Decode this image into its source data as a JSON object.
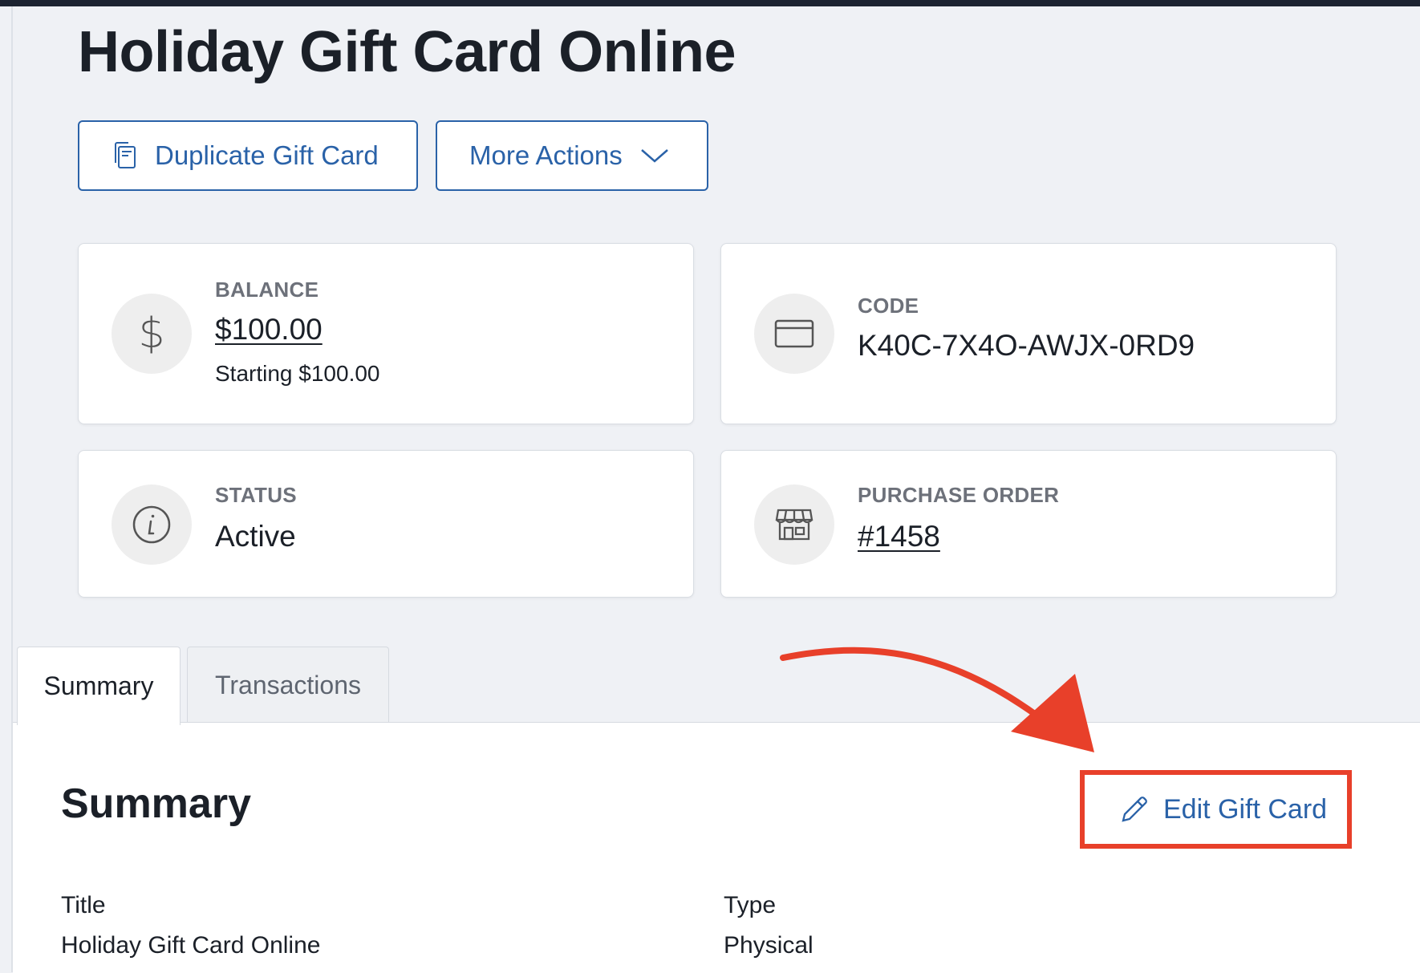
{
  "header": {
    "title": "Holiday Gift Card Online"
  },
  "actions": {
    "duplicate_label": "Duplicate Gift Card",
    "duplicate_icon": "copy-icon",
    "more_label": "More Actions",
    "more_icon": "chevron-down-icon"
  },
  "cards": {
    "balance": {
      "caption": "BALANCE",
      "value": "$100.00",
      "starting": "Starting $100.00",
      "icon": "dollar-icon"
    },
    "code": {
      "caption": "CODE",
      "value": "K40C-7X4O-AWJX-0RD9",
      "icon": "credit-card-icon"
    },
    "status": {
      "caption": "STATUS",
      "value": "Active",
      "icon": "info-icon"
    },
    "purchase_order": {
      "caption": "PURCHASE ORDER",
      "value": "#1458",
      "icon": "store-icon"
    }
  },
  "tabs": [
    {
      "label": "Summary",
      "active": true
    },
    {
      "label": "Transactions",
      "active": false
    }
  ],
  "summary": {
    "heading": "Summary",
    "edit_label": "Edit Gift Card",
    "edit_icon": "pencil-icon",
    "fields": {
      "title_label": "Title",
      "title_value": "Holiday Gift Card Online",
      "type_label": "Type",
      "type_value": "Physical"
    }
  },
  "colors": {
    "accent": "#2a62a8",
    "annotation": "#e8402a",
    "page_bg": "#eff1f5"
  }
}
